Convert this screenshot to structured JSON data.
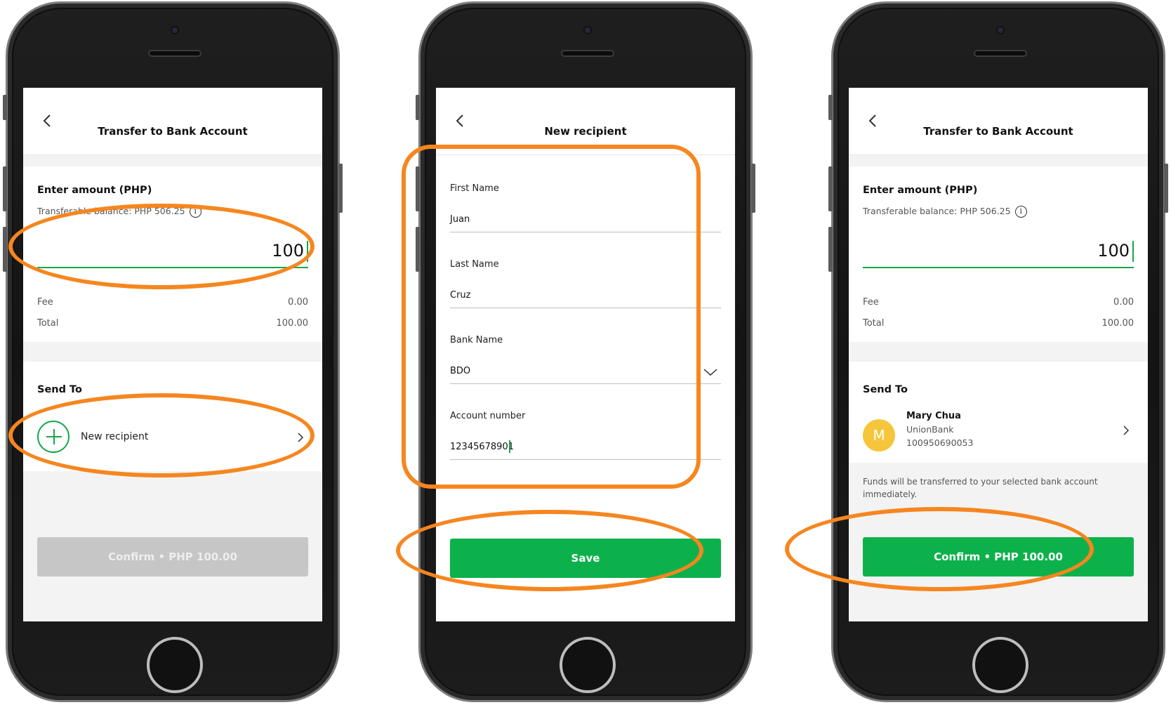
{
  "colors": {
    "accent": "#0db14b",
    "highlight": "#f6861f",
    "avatar": "#f5c63b",
    "disabled": "#c6c6c6"
  },
  "screen1": {
    "title": "Transfer to Bank Account",
    "amount_label": "Enter amount (PHP)",
    "balance_label": "Transferable balance: PHP 506.25",
    "amount_value": "100",
    "fee_label": "Fee",
    "fee_value": "0.00",
    "total_label": "Total",
    "total_value": "100.00",
    "send_to_label": "Send To",
    "new_recipient_label": "New recipient",
    "confirm_label": "Confirm • PHP 100.00"
  },
  "screen2": {
    "title": "New recipient",
    "first_name_label": "First Name",
    "first_name_value": "Juan",
    "last_name_label": "Last Name",
    "last_name_value": "Cruz",
    "bank_name_label": "Bank Name",
    "bank_name_value": "BDO",
    "account_number_label": "Account number",
    "account_number_value": "12345678901",
    "save_label": "Save"
  },
  "screen3": {
    "title": "Transfer to Bank Account",
    "amount_label": "Enter amount (PHP)",
    "balance_label": "Transferable balance: PHP 506.25",
    "amount_value": "100",
    "fee_label": "Fee",
    "fee_value": "0.00",
    "total_label": "Total",
    "total_value": "100.00",
    "send_to_label": "Send To",
    "recipient": {
      "initial": "M",
      "name": "Mary Chua",
      "bank": "UnionBank",
      "account": "100950690053"
    },
    "notice": "Funds will be transferred to your selected bank account immediately.",
    "confirm_label": "Confirm • PHP 100.00"
  },
  "icons": {
    "back": "chevron-left-icon",
    "info": "info-icon",
    "add": "plus-circle-icon",
    "forward": "chevron-right-icon",
    "dropdown": "chevron-down-icon"
  }
}
